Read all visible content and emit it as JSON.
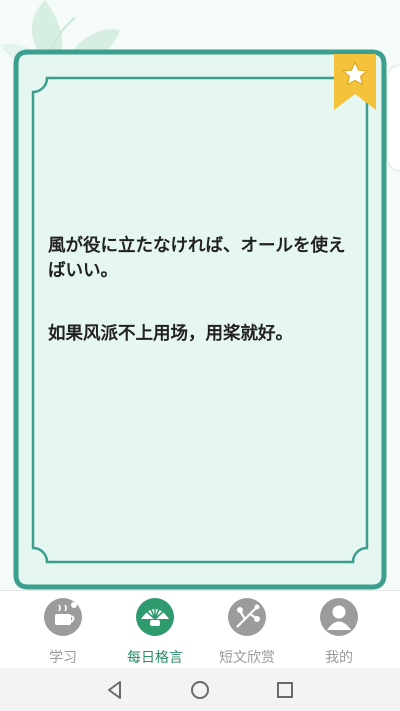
{
  "quote": {
    "japanese": "風が役に立たなければ、オールを使えばいい。",
    "chinese": "如果风派不上用场，用桨就好。"
  },
  "tabs": [
    {
      "label": "学习",
      "icon": "cup-icon",
      "active": false
    },
    {
      "label": "每日格言",
      "icon": "shell-icon",
      "active": true
    },
    {
      "label": "短文欣赏",
      "icon": "branch-icon",
      "active": false
    },
    {
      "label": "我的",
      "icon": "person-icon",
      "active": false
    }
  ],
  "colors": {
    "card_border": "#3b9e8e",
    "card_fill": "#e6f6f0",
    "bookmark": "#f5c33b",
    "tab_active": "#2a8c68",
    "tab_inactive": "#9a9a9a"
  },
  "system_nav": [
    "back-icon",
    "home-icon",
    "recents-icon"
  ]
}
